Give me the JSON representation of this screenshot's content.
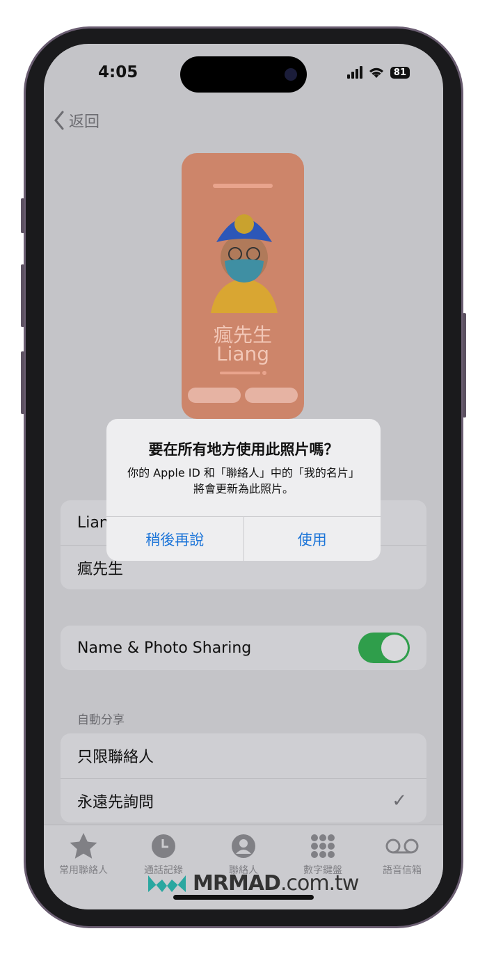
{
  "status": {
    "time": "4:05",
    "battery": "81"
  },
  "nav": {
    "back_label": "返回"
  },
  "poster": {
    "name_line1": "瘋先生",
    "name_line2": "Liang"
  },
  "name_group": {
    "first": "Liang",
    "last": "瘋先生"
  },
  "sharing": {
    "label": "Name & Photo Sharing",
    "enabled": true
  },
  "auto_share": {
    "header": "自動分享",
    "options": [
      {
        "label": "只限聯絡人",
        "selected": false
      },
      {
        "label": "永遠先詢問",
        "selected": true
      }
    ]
  },
  "alert": {
    "title": "要在所有地方使用此照片嗎？",
    "message": "你的 Apple ID 和「聯絡人」中的「我的名片」將會更新為此照片。",
    "cancel": "稍後再說",
    "confirm": "使用"
  },
  "tabs": [
    {
      "label": "常用聯絡人",
      "icon": "star-icon"
    },
    {
      "label": "通話記錄",
      "icon": "clock-icon"
    },
    {
      "label": "聯絡人",
      "icon": "person-icon"
    },
    {
      "label": "數字鍵盤",
      "icon": "keypad-icon"
    },
    {
      "label": "語音信箱",
      "icon": "voicemail-icon"
    }
  ],
  "watermark": {
    "brand": "MRMAD",
    "domain": ".com.tw"
  },
  "colors": {
    "accent": "#1b74d8",
    "toggle_on": "#2f9e4b",
    "poster": "#cd856a"
  }
}
